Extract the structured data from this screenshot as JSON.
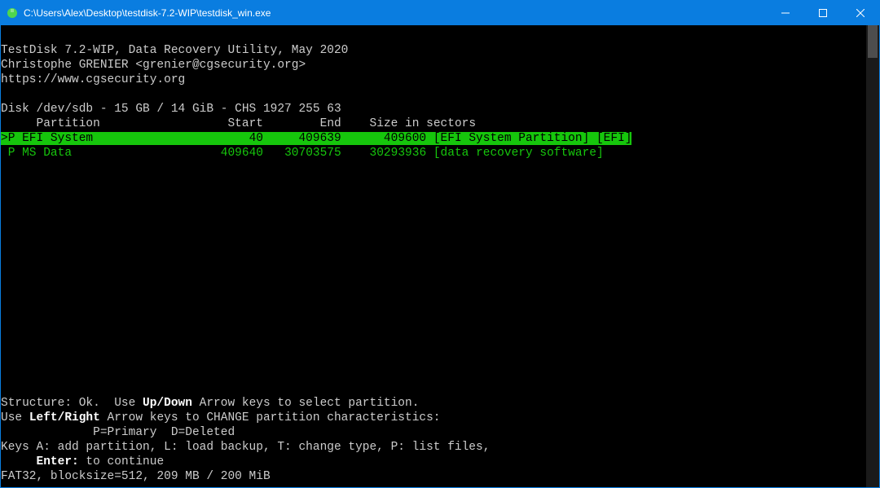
{
  "window": {
    "title": "C:\\Users\\Alex\\Desktop\\testdisk-7.2-WIP\\testdisk_win.exe"
  },
  "header": {
    "line1": "TestDisk 7.2-WIP, Data Recovery Utility, May 2020",
    "line2": "Christophe GRENIER <grenier@cgsecurity.org>",
    "line3": "https://www.cgsecurity.org"
  },
  "disk_line": "Disk /dev/sdb - 15 GB / 14 GiB - CHS 1927 255 63",
  "table": {
    "hdr_partition": "Partition",
    "hdr_start": "Start",
    "hdr_end": "End",
    "hdr_size": "Size in sectors",
    "rows": [
      {
        "selected": true,
        "marker": ">",
        "flag": "P",
        "name": "EFI System",
        "start": "40",
        "end": "409639",
        "size": "409600",
        "label": "[EFI System Partition] [EFI]"
      },
      {
        "selected": false,
        "marker": " ",
        "flag": "P",
        "name": "MS Data",
        "start": "409640",
        "end": "30703575",
        "size": "30293936",
        "label": "[data recovery software]"
      }
    ]
  },
  "footer": {
    "structure_prefix": "Structure: Ok.  Use ",
    "structure_key": "Up/Down",
    "structure_suffix": " Arrow keys to select partition.",
    "change_prefix": "Use ",
    "change_key": "Left/Right",
    "change_suffix": " Arrow keys to CHANGE partition characteristics:",
    "legend": "             P=Primary  D=Deleted",
    "keys_line": "Keys A: add partition, L: load backup, T: change type, P: list files,",
    "enter_key": "Enter:",
    "enter_suffix": " to continue",
    "fs_line": "FAT32, blocksize=512, 209 MB / 200 MiB"
  }
}
